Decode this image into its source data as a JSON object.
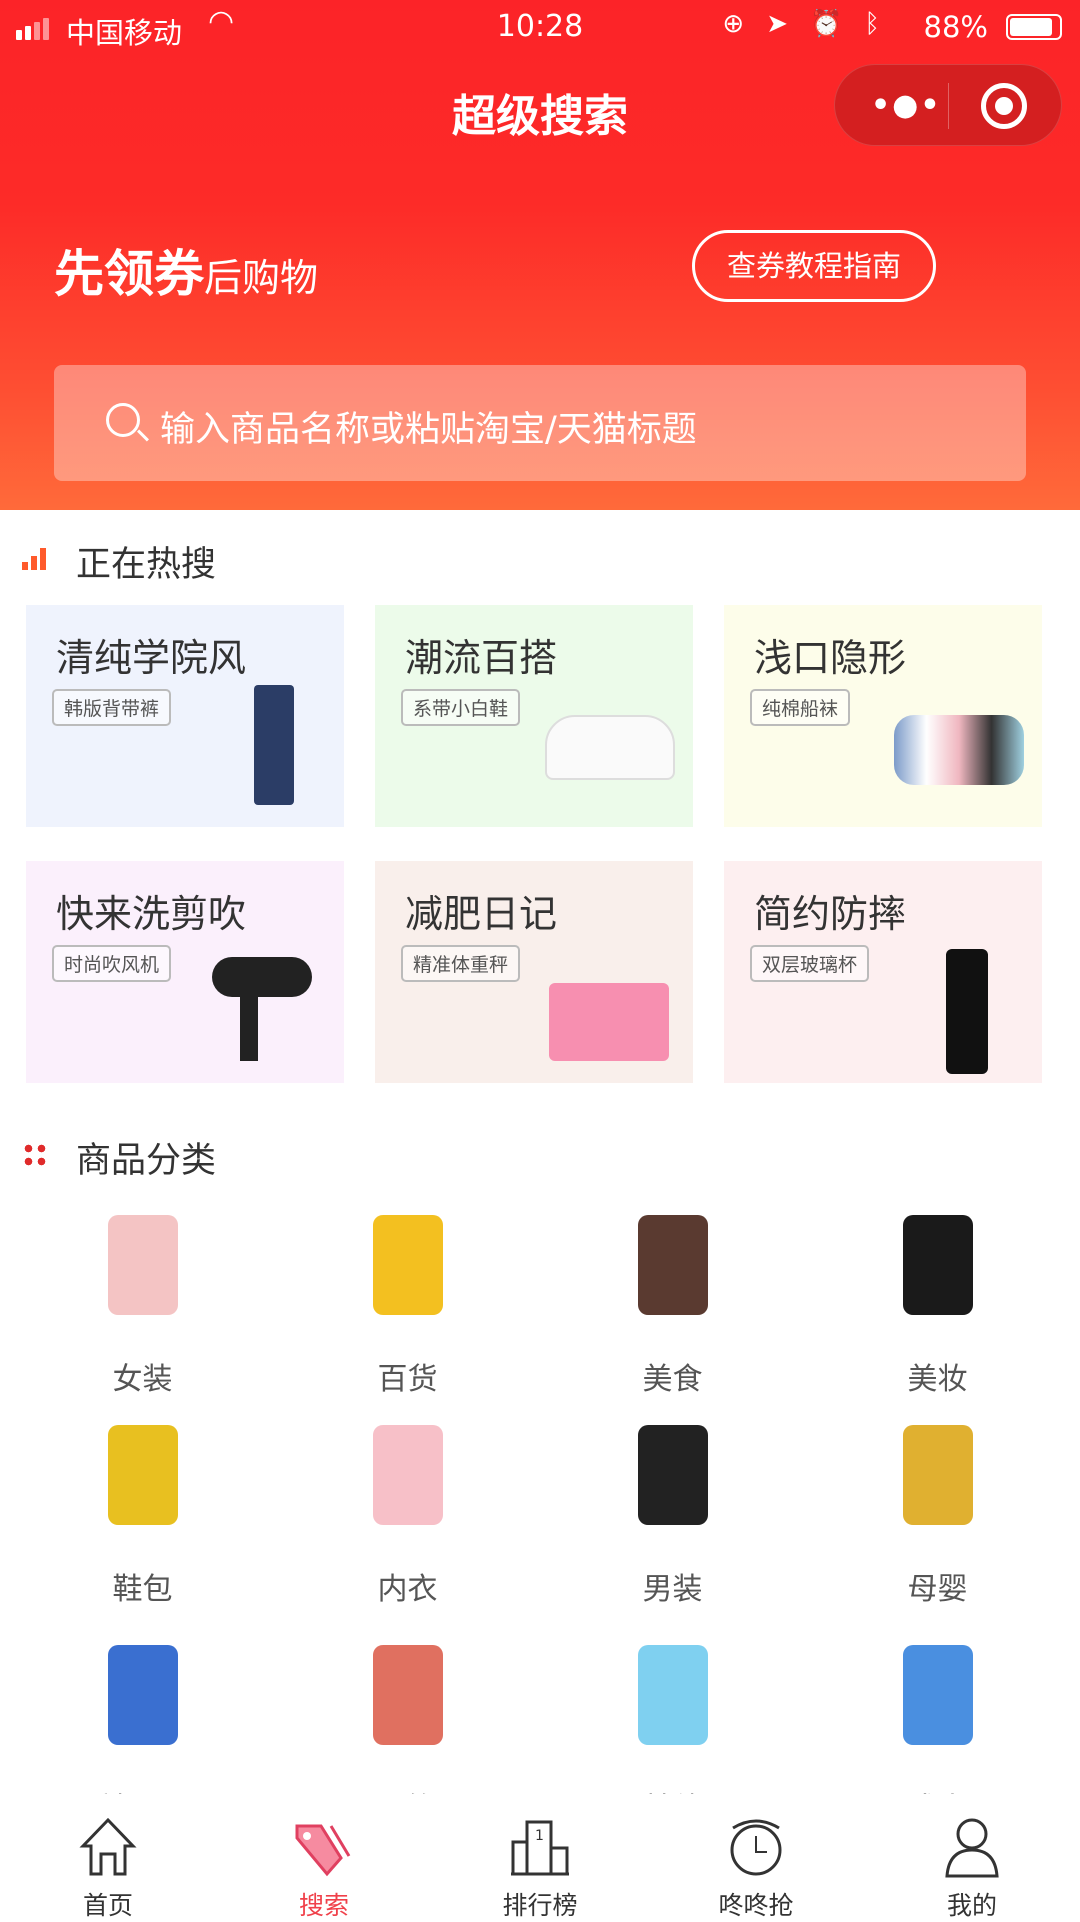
{
  "status": {
    "carrier": "中国移动",
    "time": "10:28",
    "battery": "88%"
  },
  "header": {
    "title": "超级搜索",
    "slogan_bold": "先领券",
    "slogan_rest": "后购物",
    "guide_button": "查券教程指南",
    "search_placeholder": "输入商品名称或粘贴淘宝/天猫标题"
  },
  "hot": {
    "title": "正在热搜",
    "cards": [
      {
        "title": "清纯学院风",
        "tag": "韩版背带裤",
        "bg": "#eff3fd"
      },
      {
        "title": "潮流百搭",
        "tag": "系带小白鞋",
        "bg": "#ecfbea"
      },
      {
        "title": "浅口隐形",
        "tag": "纯棉船袜",
        "bg": "#fdfdea"
      },
      {
        "title": "快来洗剪吹",
        "tag": "时尚吹风机",
        "bg": "#fbf0fc"
      },
      {
        "title": "减肥日记",
        "tag": "精准体重秤",
        "bg": "#f9efeb"
      },
      {
        "title": "简约防摔",
        "tag": "双层玻璃杯",
        "bg": "#fdeff0"
      }
    ]
  },
  "categories": {
    "title": "商品分类",
    "items": [
      "女装",
      "百货",
      "美食",
      "美妆",
      "鞋包",
      "内衣",
      "男装",
      "母婴",
      "手机周边",
      "配饰",
      "其他",
      "成人"
    ]
  },
  "nav": {
    "items": [
      "首页",
      "搜索",
      "排行榜",
      "咚咚抢",
      "我的"
    ],
    "active": 1,
    "active_color": "#f0404a"
  }
}
